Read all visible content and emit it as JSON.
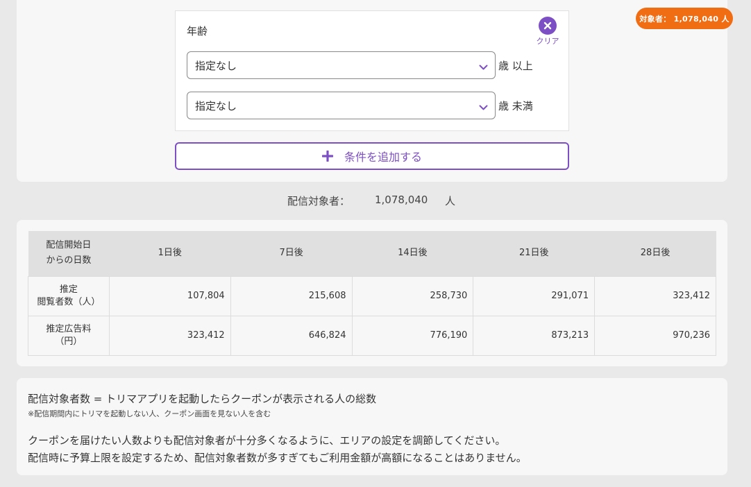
{
  "age_filter": {
    "title": "年齢",
    "clear_label": "クリア",
    "min_select": {
      "value": "指定なし",
      "suffix": "歳 以上"
    },
    "max_select": {
      "value": "指定なし",
      "suffix": "歳 未満"
    }
  },
  "add_condition_label": "条件を追加する",
  "target_badge": "対象者： 1,078,040 人",
  "target_summary": {
    "label": "配信対象者：",
    "value": "1,078,040",
    "unit": "人"
  },
  "table": {
    "corner_header": [
      "配信開始日",
      "からの日数"
    ],
    "columns": [
      "1日後",
      "7日後",
      "14日後",
      "21日後",
      "28日後"
    ],
    "rows": [
      {
        "header": [
          "推定",
          "閲覧者数（人）"
        ],
        "values": [
          "107,804",
          "215,608",
          "258,730",
          "291,071",
          "323,412"
        ]
      },
      {
        "header": [
          "推定広告料",
          "（円）"
        ],
        "values": [
          "323,412",
          "646,824",
          "776,190",
          "873,213",
          "970,236"
        ]
      }
    ]
  },
  "notes": {
    "definition": "配信対象者数 = トリマアプリを起動したらクーポンが表示される人の総数",
    "footnote": "※配信期間内にトリマを起動しない人、クーポン画面を見ない人を含む",
    "advice_1": "クーポンを届けたい人数よりも配信対象者が十分多くなるように、エリアの設定を調節してください。",
    "advice_2": "配信時に予算上限を設定するため、配信対象者数が多すぎてもご利用金額が高額になることはありません。"
  },
  "colors": {
    "accent": "#7d4fc4",
    "badge": "#f06d13",
    "background": "#e9e9e9",
    "card": "#f7f7f7"
  }
}
